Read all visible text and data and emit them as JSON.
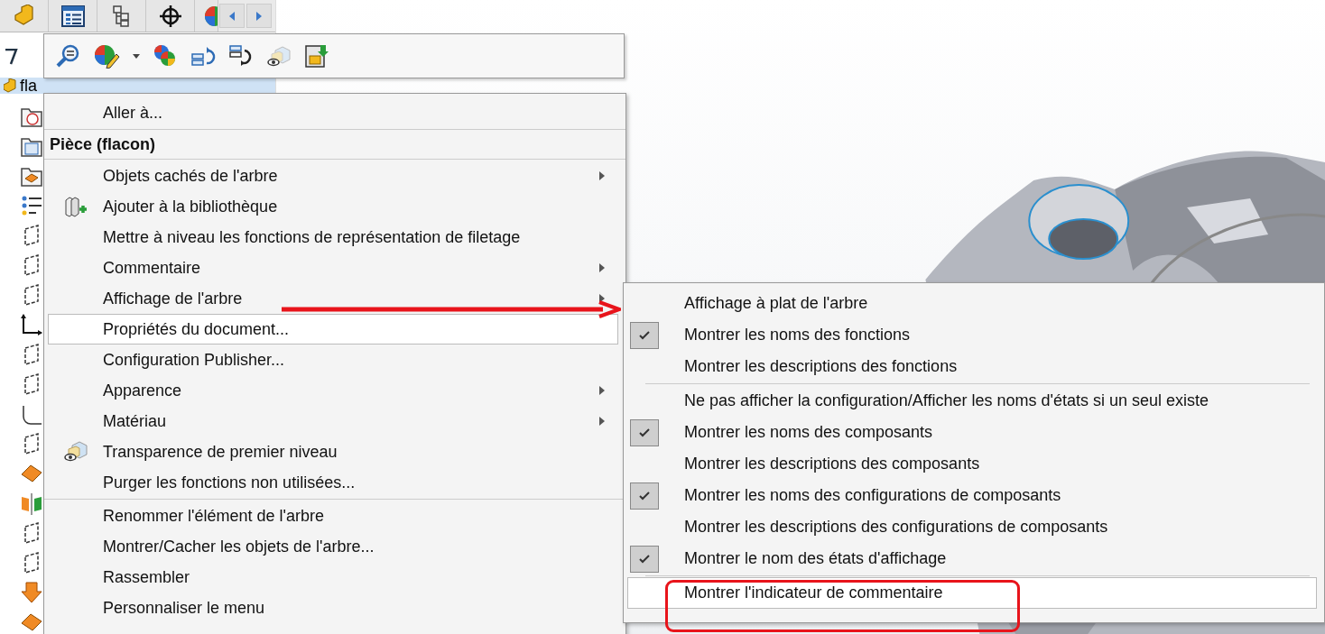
{
  "tree_panel": {
    "root_item": "fla"
  },
  "context_menu": {
    "items": [
      {
        "kind": "item",
        "label": "Aller à...",
        "selected": false,
        "submenu": false,
        "icon": false
      },
      {
        "kind": "separator"
      },
      {
        "kind": "header",
        "label": "Pièce (flacon)"
      },
      {
        "kind": "separator"
      },
      {
        "kind": "item",
        "label": "Objets cachés de l'arbre",
        "selected": false,
        "submenu": true,
        "icon": false
      },
      {
        "kind": "item",
        "label": "Ajouter à la bibliothèque",
        "selected": false,
        "submenu": false,
        "icon": true
      },
      {
        "kind": "item",
        "label": "Mettre à niveau les fonctions de représentation de filetage",
        "selected": false,
        "submenu": false,
        "icon": false
      },
      {
        "kind": "item",
        "label": "Commentaire",
        "selected": false,
        "submenu": true,
        "icon": false
      },
      {
        "kind": "item",
        "label": "Affichage de l'arbre",
        "selected": false,
        "submenu": true,
        "icon": false
      },
      {
        "kind": "item",
        "label": "Propriétés du document...",
        "selected": true,
        "submenu": false,
        "icon": false
      },
      {
        "kind": "item",
        "label": "Configuration Publisher...",
        "selected": false,
        "submenu": false,
        "icon": false
      },
      {
        "kind": "item",
        "label": "Apparence",
        "selected": false,
        "submenu": true,
        "icon": false
      },
      {
        "kind": "item",
        "label": "Matériau",
        "selected": false,
        "submenu": true,
        "icon": false
      },
      {
        "kind": "item",
        "label": "Transparence de premier niveau",
        "selected": false,
        "submenu": false,
        "icon": true
      },
      {
        "kind": "item",
        "label": "Purger les fonctions non utilisées...",
        "selected": false,
        "submenu": false,
        "icon": false
      },
      {
        "kind": "separator"
      },
      {
        "kind": "item",
        "label": "Renommer l'élément de l'arbre",
        "selected": false,
        "submenu": false,
        "icon": false
      },
      {
        "kind": "item",
        "label": "Montrer/Cacher les objets de l'arbre...",
        "selected": false,
        "submenu": false,
        "icon": false
      },
      {
        "kind": "item",
        "label": "Rassembler",
        "selected": false,
        "submenu": false,
        "icon": false
      },
      {
        "kind": "item",
        "label": "Personnaliser le menu",
        "selected": false,
        "submenu": false,
        "icon": false
      }
    ]
  },
  "submenu": {
    "items": [
      {
        "kind": "item",
        "label": "Affichage à plat de l'arbre",
        "checked": false,
        "selected": false
      },
      {
        "kind": "item",
        "label": "Montrer les noms des fonctions",
        "checked": true,
        "selected": false
      },
      {
        "kind": "item",
        "label": "Montrer les descriptions des fonctions",
        "checked": false,
        "selected": false
      },
      {
        "kind": "separator"
      },
      {
        "kind": "item",
        "label": "Ne pas afficher la configuration/Afficher les noms d'états si un seul existe",
        "checked": false,
        "selected": false
      },
      {
        "kind": "item",
        "label": "Montrer les noms des composants",
        "checked": true,
        "selected": false
      },
      {
        "kind": "item",
        "label": "Montrer les descriptions des composants",
        "checked": false,
        "selected": false
      },
      {
        "kind": "item",
        "label": "Montrer les noms des configurations de composants",
        "checked": true,
        "selected": false
      },
      {
        "kind": "item",
        "label": "Montrer les descriptions des configurations de composants",
        "checked": false,
        "selected": false
      },
      {
        "kind": "item",
        "label": "Montrer le nom des états d'affichage",
        "checked": true,
        "selected": false
      },
      {
        "kind": "separator"
      },
      {
        "kind": "item",
        "label": "Montrer l'indicateur de commentaire",
        "checked": false,
        "selected": true
      }
    ]
  }
}
